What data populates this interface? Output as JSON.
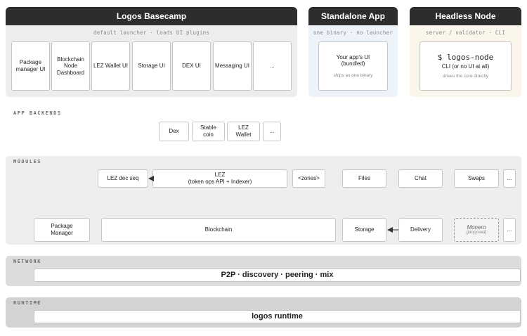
{
  "top_panels": {
    "basecamp": {
      "title": "Logos Basecamp",
      "subtitle": "default launcher · loads UI plugins",
      "plugins": [
        "Package manager UI",
        "Blockchain Node Dashboard",
        "LEZ Wallet UI",
        "Storage UI",
        "DEX UI",
        "Messaging UI",
        "..."
      ]
    },
    "standalone": {
      "title": "Standalone App",
      "subtitle": "one binary · no launcher",
      "card_title": "Your app's UI (bundled)",
      "card_note": "ships as one binary",
      "bg_color": "#eef3fa"
    },
    "headless": {
      "title": "Headless Node",
      "subtitle": "server / validator · CLI",
      "command": "$ logos-node",
      "card_title": "CLI (or no UI at all)",
      "card_note": "drives the core directly",
      "bg_color": "#faf6ec"
    }
  },
  "app_backends": {
    "label": "APP BACKENDS",
    "items": [
      "Dex",
      "Stable coin",
      "LEZ Wallet",
      "..."
    ]
  },
  "modules": {
    "label": "MODULES",
    "row1": {
      "lez_dec_seq": "LEZ dec seq",
      "lez_title": "LEZ",
      "lez_sub": "(token ops API + Indexer)",
      "zones": "<zones>",
      "files": "Files",
      "chat": "Chat",
      "swaps": "Swaps",
      "more": "..."
    },
    "row2": {
      "package_manager": "Package Manager",
      "blockchain": "Blockchain",
      "storage": "Storage",
      "delivery": "Delivery",
      "monero": "Monero",
      "monero_note": "(proposed)",
      "more": "..."
    }
  },
  "network": {
    "label": "NETWORK",
    "bar": "P2P · discovery · peering · mix"
  },
  "runtime": {
    "label": "RUNTIME",
    "bar": "logos runtime"
  },
  "colors": {
    "header_dark": "#2d2d2d",
    "panel_gray": "#ededed",
    "modules_band": "#eeeef0",
    "network_band": "#dcdcde",
    "runtime_band": "#d3d3d6"
  }
}
